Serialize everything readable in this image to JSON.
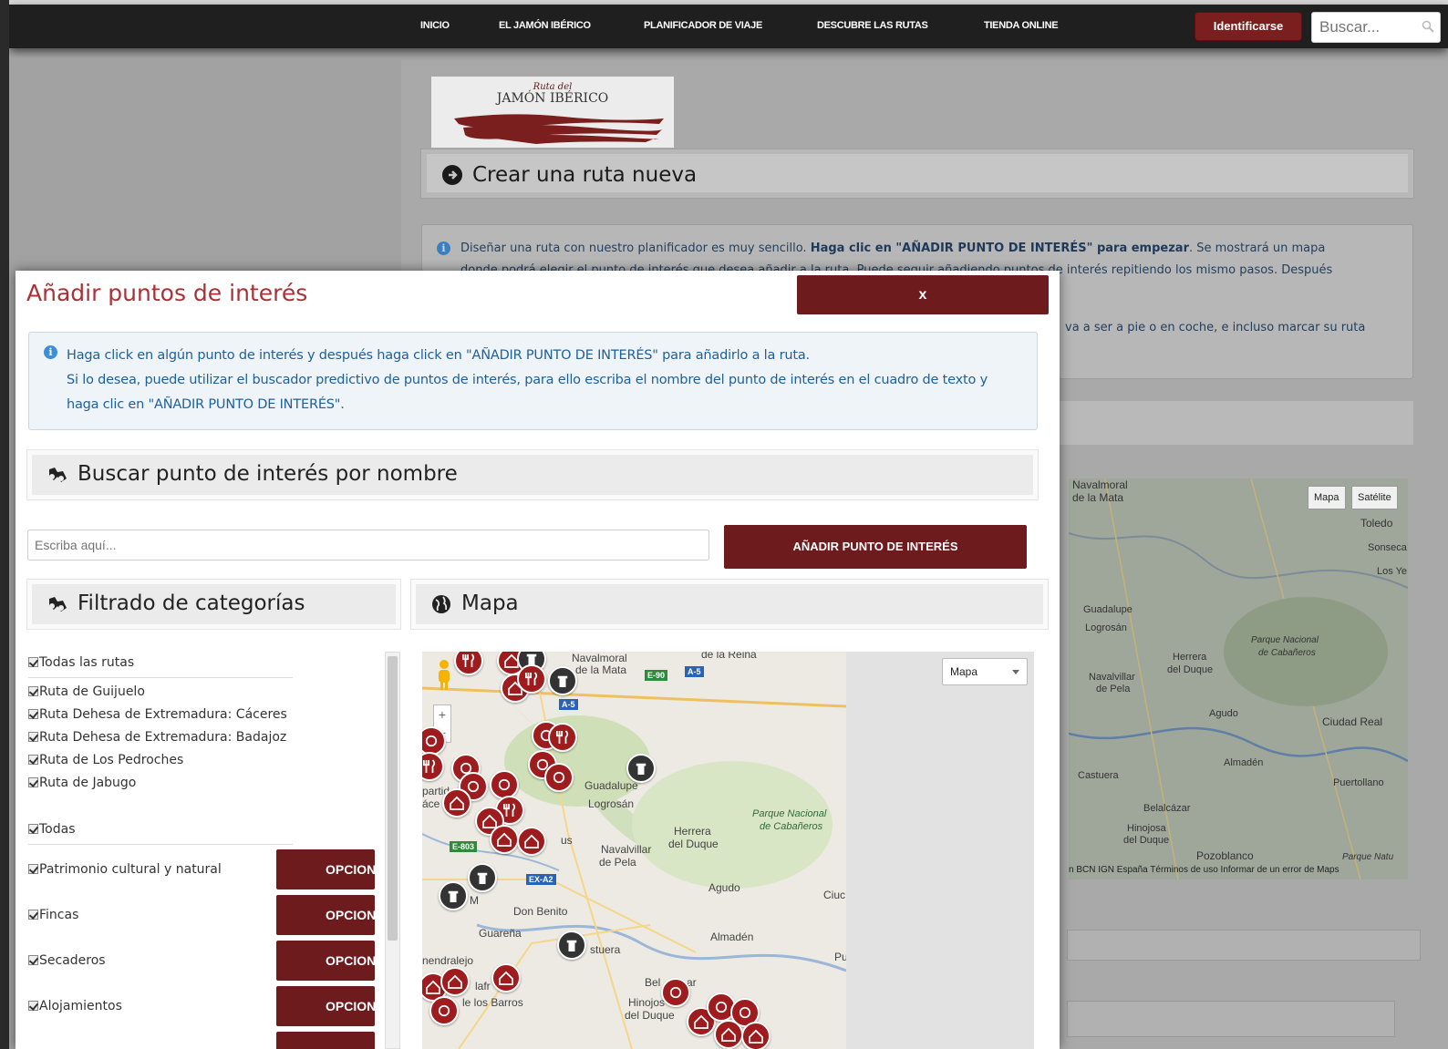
{
  "nav": {
    "items": [
      "INICIO",
      "EL JAMÓN IBÉRICO",
      "PLANIFICADOR DE VIAJE",
      "DESCUBRE LAS RUTAS",
      "TIENDA ONLINE"
    ],
    "login_label": "Identificarse",
    "search_placeholder": "Buscar..."
  },
  "background": {
    "logo_line1": "Ruta del",
    "logo_line2": "JAMÓN IBÉRICO",
    "panel_title": "Crear una ruta nueva",
    "info_text_1": "Diseñar una ruta con nuestro planificador es muy sencillo.",
    "info_text_bold": "Haga clic en \"AÑADIR PUNTO DE INTERÉS\" para empezar",
    "info_text_2": ". Se mostrará un mapa",
    "info_text_3": "donde podrá elegir el punto de interés que desea añadir a la ruta. Puede seguir añadiendo puntos de interés repitiendo los mismo pasos. Después",
    "info_tail": "va a ser a pie o en coche, e incluso marcar su ruta",
    "map_btn_map": "Mapa",
    "map_btn_sat": "Satélite",
    "map_labels": [
      "Navalmoral",
      "de la Mata",
      "Toledo",
      "Sonseca",
      "Los Ye",
      "Guadalupe",
      "Logrosán",
      "Parque Nacional",
      "de Cabañeros",
      "Herrera",
      "del Duque",
      "Navalvillar",
      "de Pela",
      "Agudo",
      "Ciudad Real",
      "Almadén",
      "Castuera",
      "Puertollano",
      "Belalcázar",
      "Hinojosa",
      "del Duque",
      "Pozoblanco",
      "Parque Natu"
    ],
    "map_footer": "n BCN IGN España   Términos de uso   Informar de un error de Maps"
  },
  "modal": {
    "title": "Añadir puntos de interés",
    "close_label": "x",
    "info_line1": "Haga click en algún punto de interés y después haga click en \"AÑADIR PUNTO DE INTERÉS\" para añadirlo a la ruta.",
    "info_line2": "Si lo desea, puede utilizar el buscador predictivo de puntos de interés, para ello escriba el nombre del punto de interés en el cuadro de texto y",
    "info_line3": "haga clic en \"AÑADIR PUNTO DE INTERÉS\".",
    "search_section_title": "Buscar punto de interés por nombre",
    "search_placeholder": "Escriba aquí...",
    "add_button_label": "AÑADIR PUNTO DE INTERÉS",
    "filter_section_title": "Filtrado de categorías",
    "map_section_title": "Mapa",
    "routes": [
      "Todas las rutas",
      "Ruta de Guijuelo",
      "Ruta Dehesa de Extremadura: Cáceres",
      "Ruta Dehesa de Extremadura: Badajoz",
      "Ruta de Los Pedroches",
      "Ruta de Jabugo"
    ],
    "categories_all": "Todas",
    "categories": [
      "Patrimonio cultural y natural",
      "Fincas",
      "Secaderos",
      "Alojamientos"
    ],
    "option_label": "OPCIONES",
    "map_type": "Mapa",
    "map_labels": [
      "Navalmoral",
      "de la Mata",
      "de la Reina",
      "Guadalupe",
      "Logrosán",
      "Parque Nacional",
      "de Cabañeros",
      "Herrera",
      "del Duque",
      "Navalvillar",
      "de Pela",
      "Agudo",
      "Ciuc",
      "Don Benito",
      "Guareña",
      "Almadén",
      "Pu",
      "nendralejo",
      "stuera",
      "Bel",
      "ar",
      "lafr",
      "le los Barros",
      "Hinojos",
      "del Duque",
      "partid",
      "áce",
      "us",
      "M"
    ],
    "road_labels": [
      "E-90",
      "A-5",
      "A-5",
      "E-803",
      "EX-A2"
    ]
  }
}
